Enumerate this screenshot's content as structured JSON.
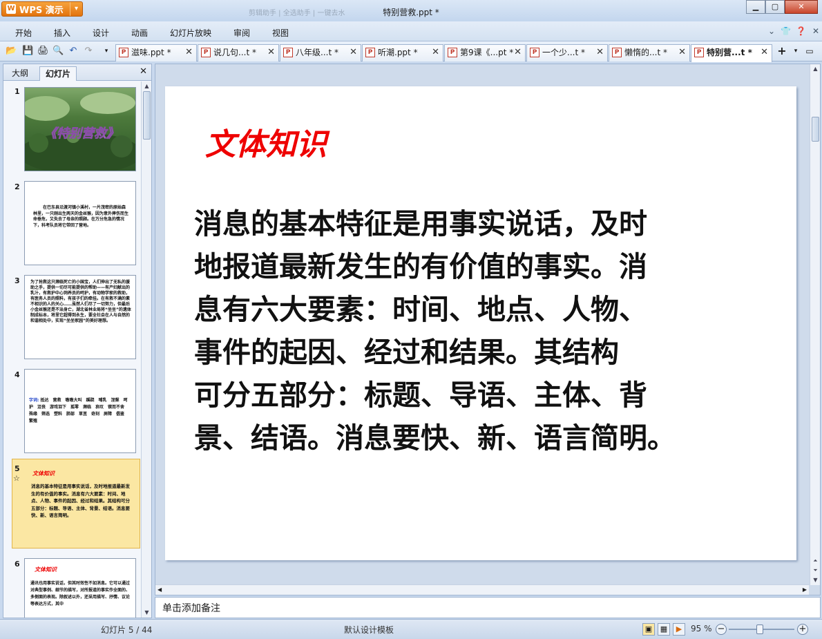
{
  "app": {
    "button_label": "WPS 演示",
    "window_title": "特别营救.ppt *",
    "faded_title": "剪辑助手 | 全选助手 | 一键去水"
  },
  "menu": [
    "开始",
    "插入",
    "设计",
    "动画",
    "幻灯片放映",
    "审阅",
    "视图"
  ],
  "doc_tabs": [
    {
      "label": "滋味.ppt *",
      "active": false
    },
    {
      "label": "说几句...t *",
      "active": false
    },
    {
      "label": "八年级...t *",
      "active": false
    },
    {
      "label": "听潮.ppt *",
      "active": false
    },
    {
      "label": "第9课《...pt *",
      "active": false
    },
    {
      "label": "一个少...t *",
      "active": false
    },
    {
      "label": "懒惰的...t *",
      "active": false
    },
    {
      "label": "特别营...t *",
      "active": true
    }
  ],
  "left_pane": {
    "tabs": [
      "大纲",
      "幻灯片"
    ],
    "active_tab": "幻灯片",
    "slides": [
      {
        "num": "1",
        "title": "《特别营救》",
        "text": ""
      },
      {
        "num": "2",
        "title": "",
        "text": "在巴东县沿渡河镇小溪村，一片茂密的原始森林里，一只刚出生两天的金丝猴，因为意外摔伤而生命垂危，又失去了母亲的照顾。在万分危急的情况下，科考队员将它带回了营地。"
      },
      {
        "num": "3",
        "title": "",
        "text": "为了抢救这只濒临死亡的小国宝，人们伸出了无私的援助之手，提供一切尽可能提供的帮助——有产妇献出的乳汁，有救护中心饲养员的呵护，有动物学家的救助，有医务人员的照料，有孩子们的牵挂。在有救不满的素不相识的人的关心……虽然人们尽了一切努力，但最后小金丝猴还是不治身亡，湖北省林业局将“坐坐”的遗体制成标本，将里它超得到永生，要全社会在人与自然的和谐相处中，实现“坐坐家园”的美好理想。"
      },
      {
        "num": "4",
        "title": "",
        "label": "字词:",
        "text": "抵达　营救　嗷嗷大叫　蹊跷　哺乳　涅槃　呵护　沮丧　游戏泪下　孤零　濒临　哀叹　锲而不舍　殊缘　筛选　塑料　肺部　草苴　奇刻　屏障　倡鉴　繁殖"
      },
      {
        "num": "5",
        "title": "文体知识",
        "text": "消息的基本特征是用事实说话，及时地报道最新发生的有价值的事实。消息有六大要素：时间、地点、人物、事件的起因、经过和结果。其结构可分五部分：标题、导语、主体、背景、结语。消息要快、新、语言简明。"
      },
      {
        "num": "6",
        "title": "文体知识",
        "text": "通讯也用事实说话，但其时效性不如消息。它可以通过对典型事例、细节的描写，对所报道的事实作全面的、多侧面的表现。除叙述以外，还采用描写、抒情、议论等表达方式，其中"
      }
    ]
  },
  "slide": {
    "title": "文体知识",
    "lines": [
      "消息的基本特征是用事实说话，及时",
      "地报道最新发生的有价值的事实。消",
      "息有六大要素：时间、地点、人物、",
      "事件的起因、经过和结果。其结构",
      "可分五部分：标题、导语、主体、背",
      "景、结语。消息要快、新、语言简明。"
    ]
  },
  "notes_placeholder": "单击添加备注",
  "status": {
    "slide_counter": "幻灯片 5 / 44",
    "template": "默认设计模板",
    "zoom": "95 %"
  },
  "colors": {
    "accent_title": "#ee0000",
    "selected_thumb_bg": "#fbe7a3",
    "wps_orange": "#e2730f"
  }
}
